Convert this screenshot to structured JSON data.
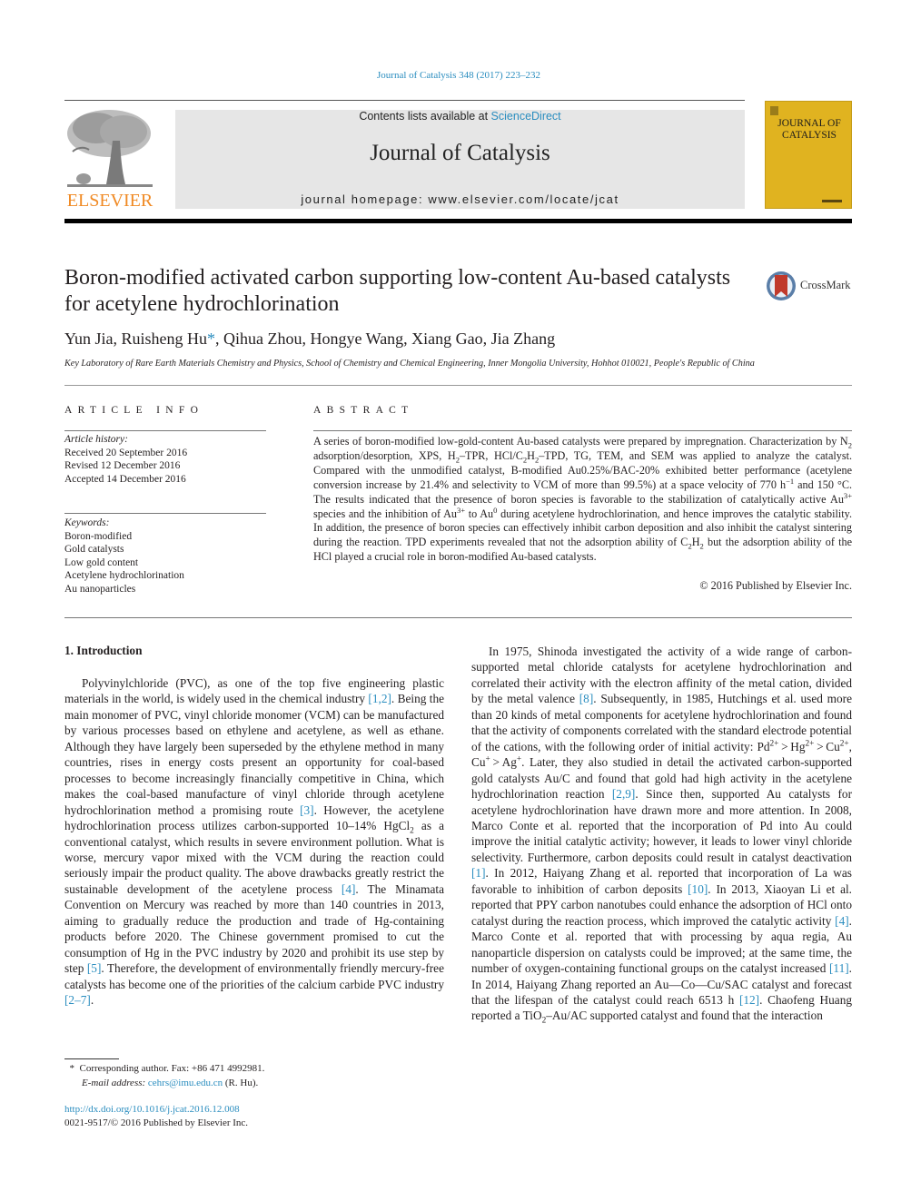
{
  "header": {
    "citation": "Journal of Catalysis 348 (2017) 223–232",
    "contents_prefix": "Contents lists available at ",
    "contents_link": "ScienceDirect",
    "journal_name": "Journal of Catalysis",
    "homepage": "journal homepage: www.elsevier.com/locate/jcat",
    "publisher_logo_text": "ELSEVIER",
    "cover_title_line1": "JOURNAL OF",
    "cover_title_line2": "CATALYSIS",
    "brand_colors": {
      "elsevier_orange": "#f08a24",
      "link_blue": "#2a8dbf",
      "cover_gold": "#e0b320",
      "band_grey": "#e6e6e6"
    }
  },
  "article": {
    "title": "Boron-modified activated carbon supporting low-content Au-based catalysts for acetylene hydrochlorination",
    "crossmark_label": "CrossMark",
    "authors_before": "Yun Jia, Ruisheng Hu",
    "author_star": "*",
    "authors_after": ", Qihua Zhou, Hongye Wang, Xiang Gao, Jia Zhang",
    "affiliation": "Key Laboratory of Rare Earth Materials Chemistry and Physics, School of Chemistry and Chemical Engineering, Inner Mongolia University, Hohhot 010021, People's Republic of China"
  },
  "article_info": {
    "heading": "ARTICLE INFO",
    "history_label": "Article history:",
    "history": [
      "Received 20 September 2016",
      "Revised 12 December 2016",
      "Accepted 14 December 2016"
    ],
    "keywords_label": "Keywords:",
    "keywords": [
      "Boron-modified",
      "Gold catalysts",
      "Low gold content",
      "Acetylene hydrochlorination",
      "Au nanoparticles"
    ]
  },
  "abstract": {
    "heading": "ABSTRACT",
    "copyright": "© 2016 Published by Elsevier Inc."
  },
  "intro": {
    "heading": "1. Introduction",
    "refs": {
      "r1_2": "[1,2]",
      "r3": "[3]",
      "r4": "[4]",
      "r5": "[5]",
      "r2_7": "[2–7]",
      "r8": "[8]",
      "r2_9": "[2,9]",
      "r1": "[1]",
      "r10": "[10]",
      "r11": "[11]",
      "r12": "[12]"
    }
  },
  "footnotes": {
    "star": "*",
    "corresponding": "Corresponding author. Fax: +86 471 4992981.",
    "email_label": "E-mail address: ",
    "email": "cehrs@imu.edu.cn",
    "email_suffix": " (R. Hu).",
    "doi": "http://dx.doi.org/10.1016/j.jcat.2016.12.008",
    "issn": "0021-9517/© 2016 Published by Elsevier Inc."
  }
}
